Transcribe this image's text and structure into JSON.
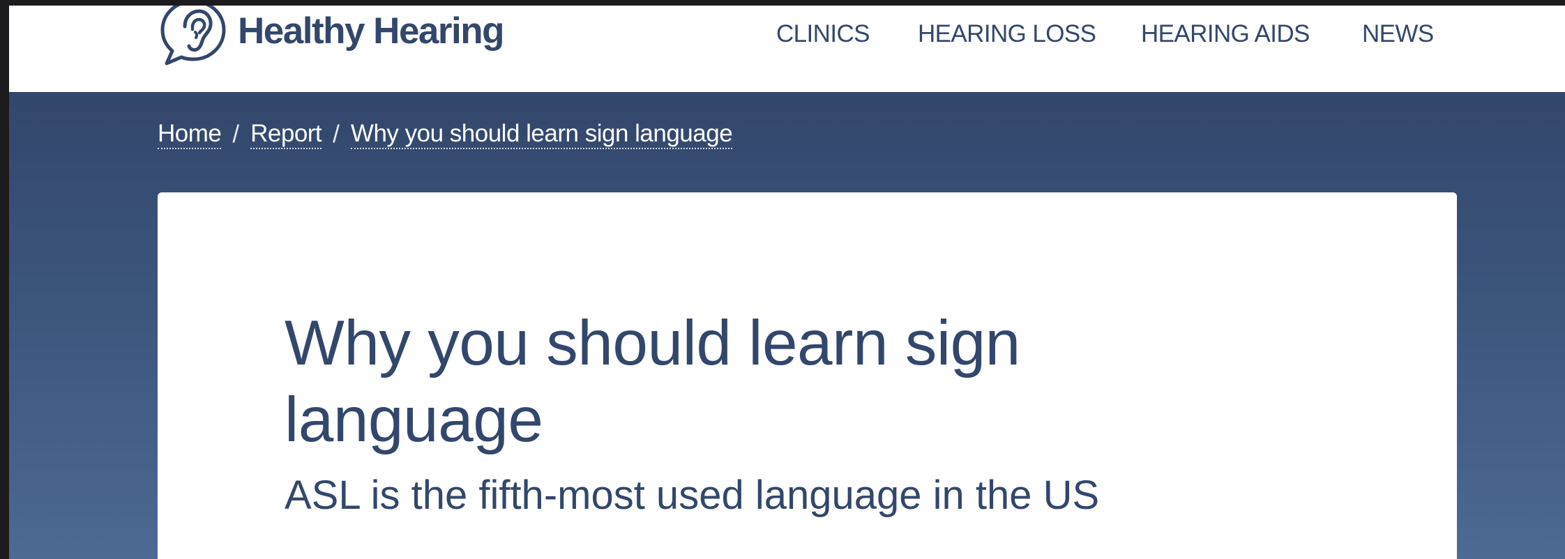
{
  "brand": {
    "name": "Healthy Hearing",
    "color": "#33476c"
  },
  "nav": {
    "items": [
      {
        "label": "CLINICS"
      },
      {
        "label": "HEARING LOSS"
      },
      {
        "label": "HEARING AIDS"
      },
      {
        "label": "NEWS"
      }
    ]
  },
  "breadcrumb": {
    "items": [
      {
        "label": "Home"
      },
      {
        "label": "Report"
      },
      {
        "label": "Why you should learn sign language"
      }
    ],
    "separator": "/"
  },
  "article": {
    "title": "Why you should learn sign language",
    "subtitle": "ASL is the fifth-most used language in the US"
  },
  "icons": {
    "logo": "ear-speech-bubble-icon"
  },
  "colors": {
    "header_bg": "#ffffff",
    "hero_bg": "#33476c",
    "text_primary": "#33476c"
  }
}
